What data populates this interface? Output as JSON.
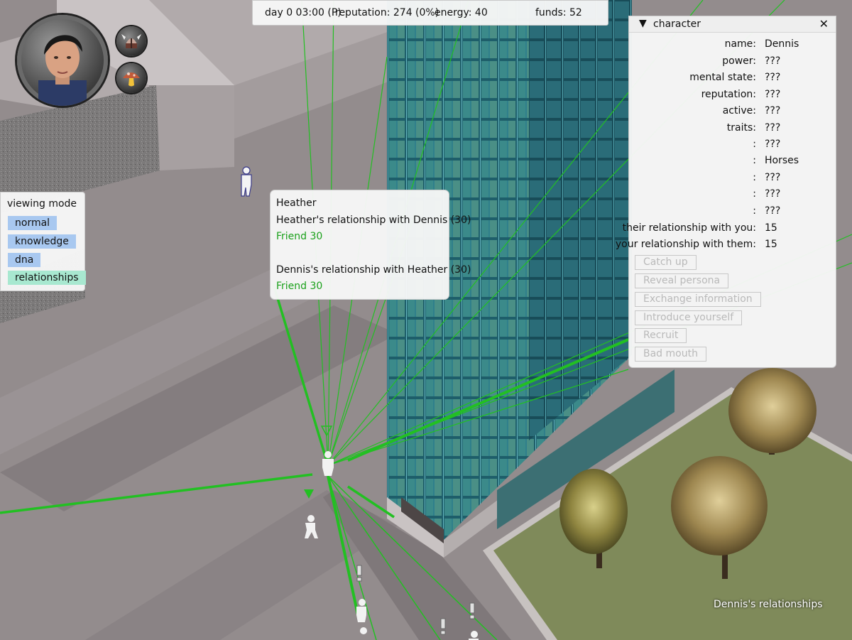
{
  "status": {
    "time": "day 0 03:00 (P)",
    "reputation": "reputation: 274 (0%)",
    "energy": "energy: 40",
    "funds": "funds: 52"
  },
  "viewing_mode": {
    "title": "viewing mode",
    "modes": [
      "normal",
      "knowledge",
      "dna",
      "relationships"
    ],
    "active": "relationships"
  },
  "tooltip": {
    "name": "Heather",
    "rel1_heading": "Heather's relationship with Dennis (30)",
    "rel1_value": "Friend 30",
    "rel2_heading": "Dennis's relationship with Heather (30)",
    "rel2_value": "Friend 30"
  },
  "character": {
    "title": "character",
    "toggle_icon": "▼",
    "close_icon": "✕",
    "fields": [
      {
        "key": "name:",
        "value": "Dennis"
      },
      {
        "key": "power:",
        "value": "???"
      },
      {
        "key": "mental state:",
        "value": "???"
      },
      {
        "key": "reputation:",
        "value": "???"
      },
      {
        "key": "active:",
        "value": "???"
      },
      {
        "key": "traits:",
        "value": "???"
      },
      {
        "key": ":",
        "value": "???"
      },
      {
        "key": ":",
        "value": "Horses"
      },
      {
        "key": ":",
        "value": "???"
      },
      {
        "key": ":",
        "value": "???"
      },
      {
        "key": ":",
        "value": "???"
      },
      {
        "key": "their relationship with you:",
        "value": "15"
      },
      {
        "key": "your relationship with them:",
        "value": "15"
      }
    ],
    "actions": [
      "Catch up",
      "Reveal persona",
      "Exchange information",
      "Introduce yourself",
      "Recruit",
      "Bad mouth"
    ]
  },
  "relationships_caption": "Dennis's relationships",
  "colors": {
    "relation_line": "#22c022",
    "panel_bg": "#f7f7f7",
    "mode_button": "#a8c8f0",
    "mode_button_active": "#a8e8d0",
    "friend_text": "#1aa01a"
  },
  "icons": [
    "portrait-avatar",
    "viking-helmet-icon",
    "mushroom-icon",
    "marker-triangle-icon",
    "exclamation-icon"
  ]
}
